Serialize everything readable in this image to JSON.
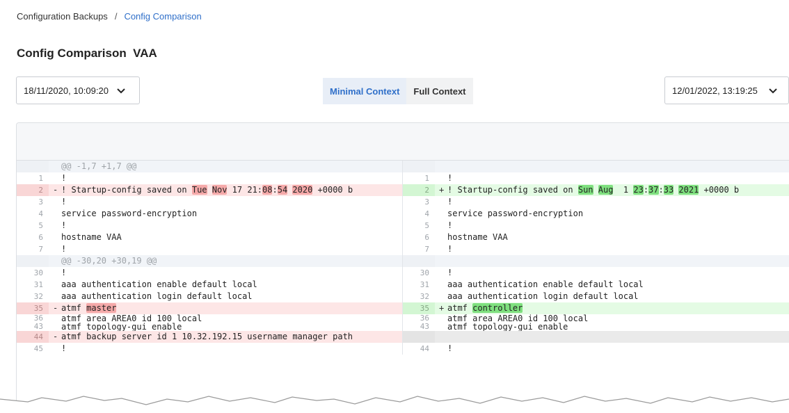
{
  "breadcrumb": {
    "parent": "Configuration Backups",
    "separator": "/",
    "current": "Config Comparison"
  },
  "page_title": "Config Comparison  VAA",
  "left_date": "18/11/2020, 10:09:20",
  "right_date": "12/01/2022, 13:19:25",
  "context": {
    "minimal": "Minimal Context",
    "full": "Full Context",
    "selected": "minimal"
  },
  "colors": {
    "accent": "#2f6fc9",
    "deleted_bg": "#fde6e6",
    "deleted_highlight": "#f5a9a9",
    "added_bg": "#e4fbe4",
    "added_highlight": "#7fe07f"
  },
  "diff": {
    "hunks": [
      {
        "header": "@@ -1,7 +1,7 @@",
        "rows": [
          {
            "type": "same",
            "left_num": "1",
            "right_num": "1",
            "left": "!",
            "right": "!"
          },
          {
            "type": "change",
            "left_num": "2",
            "right_num": "2",
            "left_segments": [
              {
                "t": "! Startup-config saved on "
              },
              {
                "t": "Tue",
                "h": true
              },
              {
                "t": " "
              },
              {
                "t": "Nov",
                "h": true
              },
              {
                "t": " 17 21:"
              },
              {
                "t": "08",
                "h": true
              },
              {
                "t": ":"
              },
              {
                "t": "54",
                "h": true
              },
              {
                "t": " "
              },
              {
                "t": "2020",
                "h": true
              },
              {
                "t": " +0000 b"
              }
            ],
            "right_segments": [
              {
                "t": "! Startup-config saved on "
              },
              {
                "t": "Sun",
                "h": true
              },
              {
                "t": " "
              },
              {
                "t": "Aug",
                "h": true
              },
              {
                "t": "  1 "
              },
              {
                "t": "23",
                "h": true
              },
              {
                "t": ":"
              },
              {
                "t": "37",
                "h": true
              },
              {
                "t": ":"
              },
              {
                "t": "33",
                "h": true
              },
              {
                "t": " "
              },
              {
                "t": "2021",
                "h": true
              },
              {
                "t": " +0000 b"
              }
            ]
          },
          {
            "type": "same",
            "left_num": "3",
            "right_num": "3",
            "left": "!",
            "right": "!"
          },
          {
            "type": "same",
            "left_num": "4",
            "right_num": "4",
            "left": "service password-encryption",
            "right": "service password-encryption"
          },
          {
            "type": "same",
            "left_num": "5",
            "right_num": "5",
            "left": "!",
            "right": "!"
          },
          {
            "type": "same",
            "left_num": "6",
            "right_num": "6",
            "left": "hostname VAA",
            "right": "hostname VAA"
          },
          {
            "type": "same",
            "left_num": "7",
            "right_num": "7",
            "left": "!",
            "right": "!"
          }
        ]
      },
      {
        "header": "@@ -30,20 +30,19 @@",
        "rows": [
          {
            "type": "same",
            "left_num": "30",
            "right_num": "30",
            "left": "!",
            "right": "!"
          },
          {
            "type": "same",
            "left_num": "31",
            "right_num": "31",
            "left": "aaa authentication enable default local",
            "right": "aaa authentication enable default local"
          },
          {
            "type": "same",
            "left_num": "32",
            "right_num": "32",
            "left": "aaa authentication login default local",
            "right": "aaa authentication login default local"
          },
          {
            "type": "change",
            "left_num": "35",
            "right_num": "35",
            "left_segments": [
              {
                "t": "atmf "
              },
              {
                "t": "master",
                "h": true
              }
            ],
            "right_segments": [
              {
                "t": "atmf "
              },
              {
                "t": "controller",
                "h": true
              }
            ]
          },
          {
            "type": "same",
            "compact": true,
            "left_num": "36",
            "right_num": "36",
            "left": "atmf area AREA0 id 100 local",
            "right": "atmf area AREA0 id 100 local"
          },
          {
            "type": "same",
            "compact": true,
            "left_num": "43",
            "right_num": "43",
            "left": "atmf topology-gui enable",
            "right": "atmf topology-gui enable"
          },
          {
            "type": "delete",
            "left_num": "44",
            "left": "atmf backup server id 1 10.32.192.15 username manager path"
          },
          {
            "type": "same",
            "left_num": "45",
            "right_num": "44",
            "left": "!",
            "right": "!"
          }
        ]
      }
    ]
  }
}
